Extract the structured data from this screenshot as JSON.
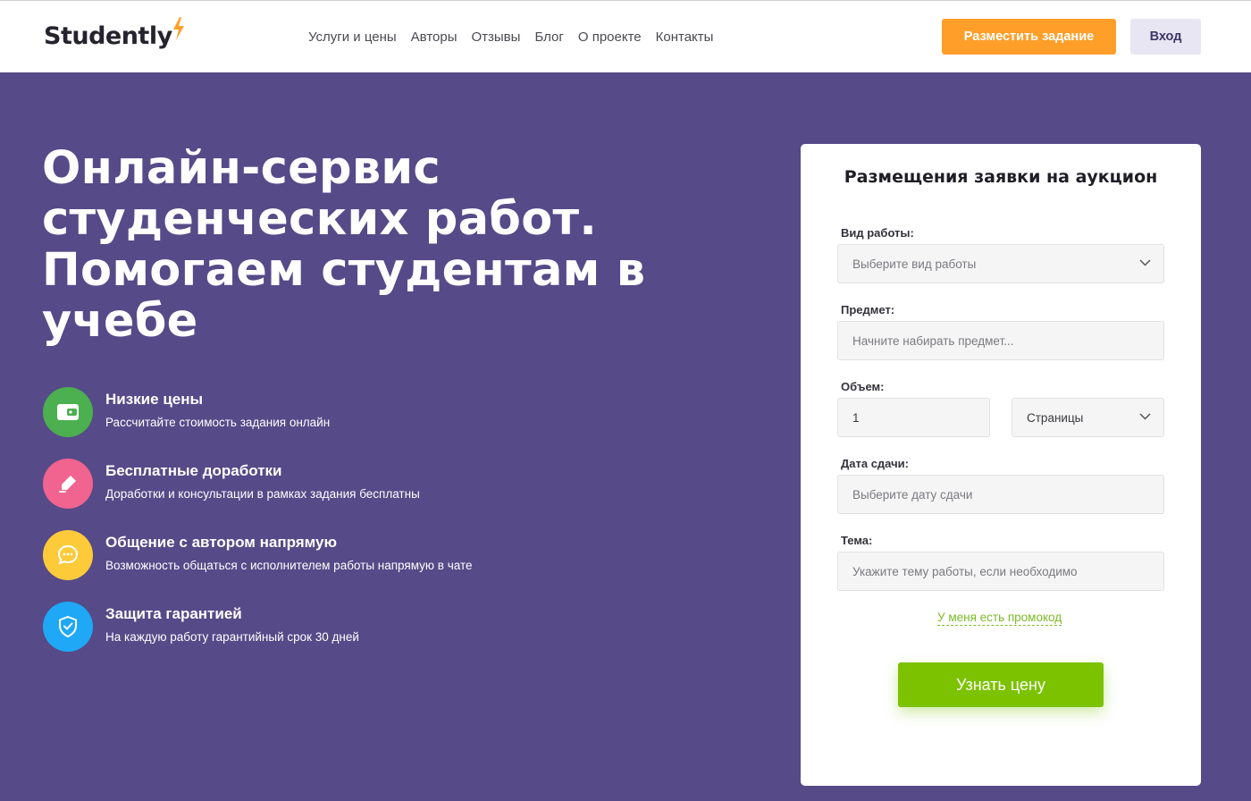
{
  "header": {
    "logo_text": "Studently",
    "nav": [
      "Услуги и цены",
      "Авторы",
      "Отзывы",
      "Блог",
      "О проекте",
      "Контакты"
    ],
    "post_button": "Разместить задание",
    "login_button": "Вход"
  },
  "hero": {
    "title_lines": [
      "Онлайн-сервис",
      "студенческих работ.",
      "Помогаем студентам в",
      "учебе"
    ]
  },
  "features": [
    {
      "icon": "wallet-icon",
      "color": "#4caf50",
      "title": "Низкие цены",
      "desc": "Рассчитайте стоимость задания онлайн"
    },
    {
      "icon": "pencil-icon",
      "color": "#f0648f",
      "title": "Бесплатные доработки",
      "desc": "Доработки и консультации в рамках задания бесплатны"
    },
    {
      "icon": "chat-icon",
      "color": "#fdcb3a",
      "title": "Общение с автором напрямую",
      "desc": "Возможность общаться с исполнителем работы напрямую в чате"
    },
    {
      "icon": "shield-check-icon",
      "color": "#1fa8f5",
      "title": "Защита гарантией",
      "desc": "На каждую работу гарантийный срок 30 дней"
    }
  ],
  "form": {
    "title": "Размещения заявки на аукцион",
    "work_type": {
      "label": "Вид работы:",
      "placeholder": "Выберите вид работы"
    },
    "subject": {
      "label": "Предмет:",
      "placeholder": "Начните набирать предмет..."
    },
    "volume": {
      "label": "Объем:",
      "value": "1",
      "unit": "Страницы"
    },
    "deadline": {
      "label": "Дата сдачи:",
      "placeholder": "Выберите дату сдачи"
    },
    "topic": {
      "label": "Тема:",
      "placeholder": "Укажите тему работы, если необходимо"
    },
    "promo_link": "У меня есть промокод",
    "submit": "Узнать цену"
  },
  "colors": {
    "hero_bg": "#564a88",
    "accent_orange": "#ff9f2a",
    "accent_green": "#7cc200"
  }
}
